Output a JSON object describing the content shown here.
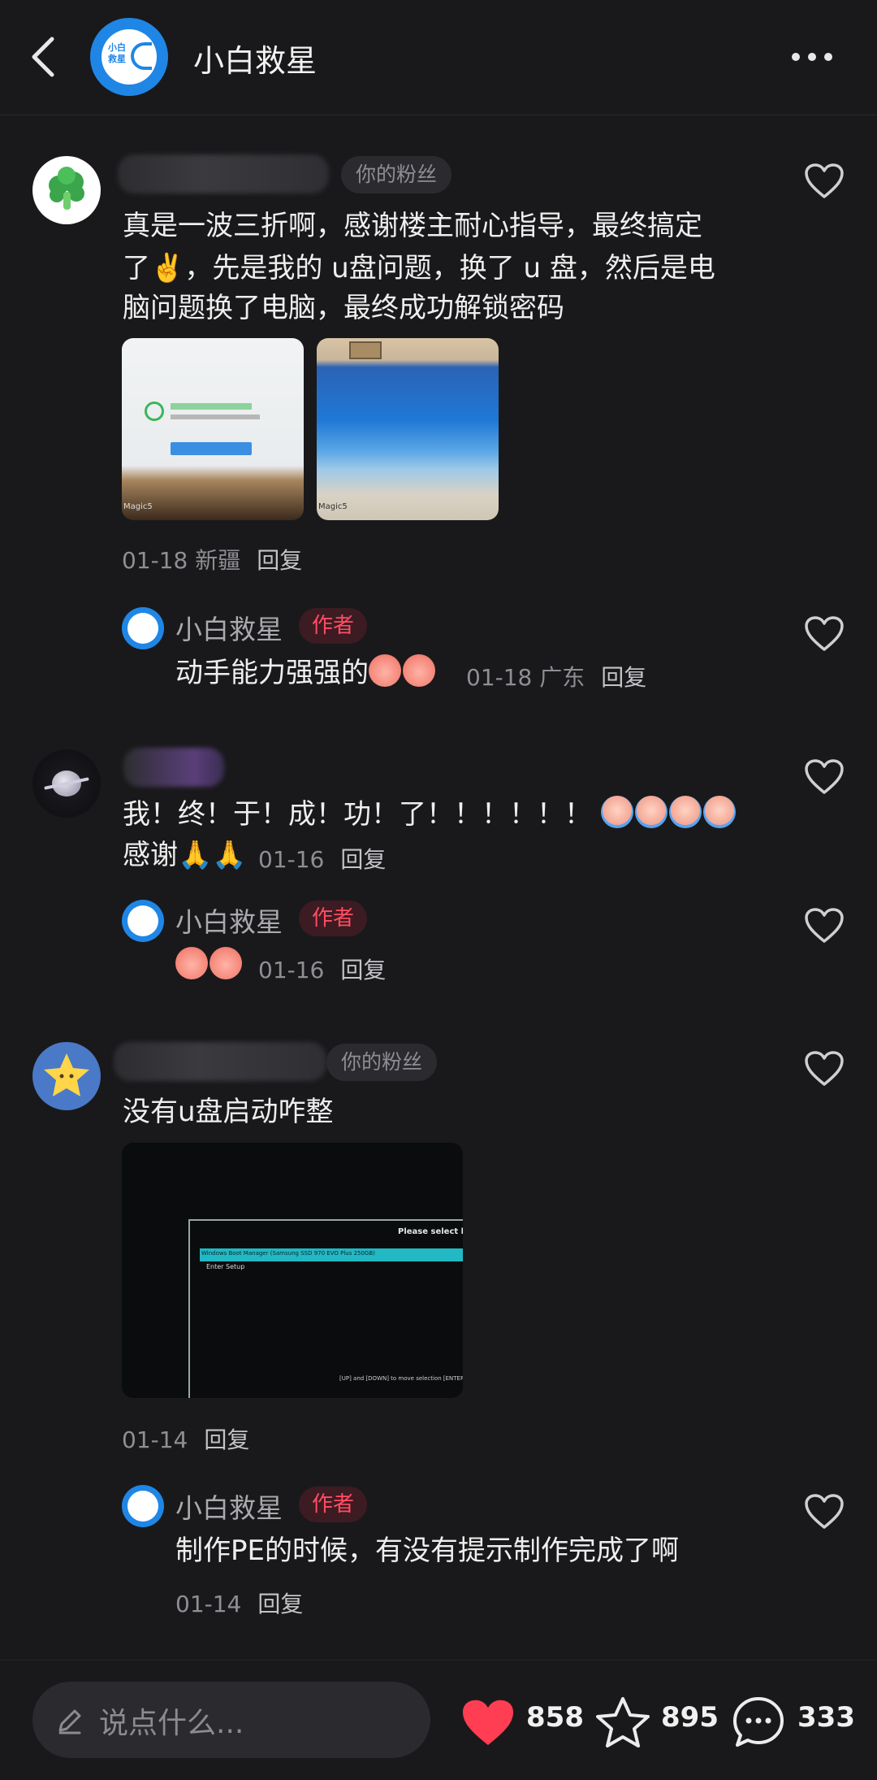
{
  "header": {
    "title": "小白救星",
    "avatar_text": "小白救星"
  },
  "comments": [
    {
      "badge": "你的粉丝",
      "text_lines": [
        "真是一波三折啊，感谢楼主耐心指导，最终搞定",
        "了✌️，先是我的 u盘问题，换了 u 盘，然后是电",
        "脑问题换了电脑，最终成功解锁密码"
      ],
      "image1_caption": "Magic5",
      "image2_caption": "Magic5",
      "meta": "01-18 新疆",
      "reply": "回复",
      "author_reply": {
        "name": "小白救星",
        "tag": "作者",
        "text": "动手能力强强的",
        "meta": "01-18 广东",
        "reply": "回复"
      }
    },
    {
      "text_line1": "我！终！于！成！功！了！！！！！！",
      "text_line2": "感谢🙏🙏",
      "meta": "01-16",
      "reply": "回复",
      "author_reply": {
        "name": "小白救星",
        "tag": "作者",
        "meta": "01-16",
        "reply": "回复"
      }
    },
    {
      "badge": "你的粉丝",
      "text": "没有u盘启动咋整",
      "boot_screen": {
        "title": "Please select boot",
        "option1": "Windows Boot Manager (Samsung SSD 970 EVO Plus 250GB)",
        "option2": "Enter Setup",
        "footer": "[UP] and [DOWN] to move selection [ENTER"
      },
      "meta": "01-14",
      "reply": "回复",
      "author_reply": {
        "name": "小白救星",
        "tag": "作者",
        "text": "制作PE的时候，有没有提示制作完成了啊",
        "meta": "01-14",
        "reply": "回复"
      }
    }
  ],
  "bottom_bar": {
    "placeholder": "说点什么...",
    "likes": "858",
    "stars": "895",
    "comments": "333"
  },
  "colors": {
    "accent_red": "#ff3d53",
    "author_tag": "#ff4d63",
    "brand_blue": "#1f86e6"
  }
}
